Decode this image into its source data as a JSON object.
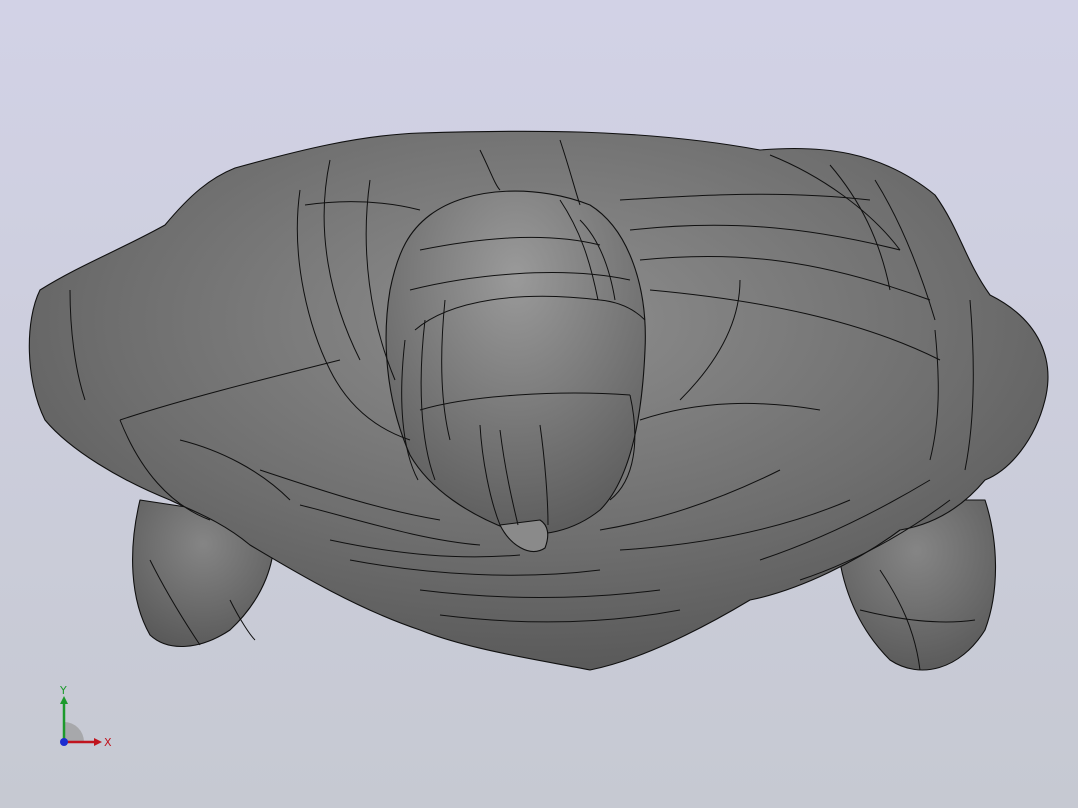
{
  "viewport": {
    "background_top": "#d2d2e6",
    "background_bottom": "#c6c9d2"
  },
  "model": {
    "body_color": "#787878",
    "edge_color": "#101010"
  },
  "triad": {
    "x_label": "X",
    "y_label": "Y",
    "x_color": "#c0141e",
    "y_color": "#1c9a2c",
    "z_color": "#1c2cd0"
  }
}
